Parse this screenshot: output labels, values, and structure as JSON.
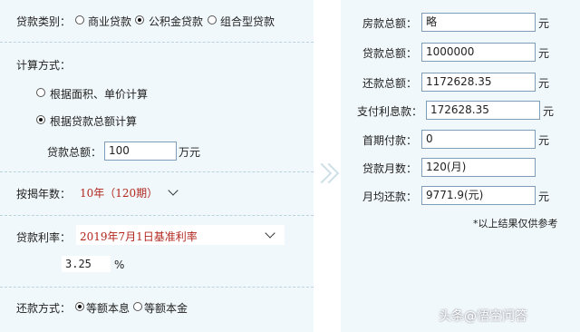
{
  "loan_type": {
    "label": "贷款类别：",
    "options": [
      "商业贷款",
      "公积金贷款",
      "组合型贷款"
    ],
    "selected_index": 1
  },
  "calc_method": {
    "label": "计算方式：",
    "options": [
      "根据面积、单价计算",
      "根据贷款总额计算"
    ],
    "selected_index": 1,
    "amount_label": "贷款总额：",
    "amount_value": "100",
    "amount_unit": "万元"
  },
  "term": {
    "label": "按揭年数：",
    "value": "10年（120期）"
  },
  "rate": {
    "label": "贷款利率：",
    "value": "2019年7月1日基准利率",
    "percent_value": "3.25",
    "percent_unit": "%"
  },
  "repay_method": {
    "label": "还款方式：",
    "options": [
      "等额本息",
      "等额本金"
    ],
    "selected_index": 0
  },
  "results": {
    "rows": [
      {
        "label": "房款总额：",
        "value": "略",
        "unit": "元"
      },
      {
        "label": "贷款总额：",
        "value": "1000000",
        "unit": "元"
      },
      {
        "label": "还款总额：",
        "value": "1172628.35",
        "unit": "元"
      },
      {
        "label": "支付利息款：",
        "value": "172628.35",
        "unit": "元"
      },
      {
        "label": "首期付款：",
        "value": "0",
        "unit": "元"
      },
      {
        "label": "贷款月数：",
        "value": "120(月)",
        "unit": ""
      },
      {
        "label": "月均还款：",
        "value": "9771.9(元)",
        "unit": "元"
      }
    ],
    "note": "*以上结果仅供参考"
  },
  "watermark": "头条@悟空问答"
}
